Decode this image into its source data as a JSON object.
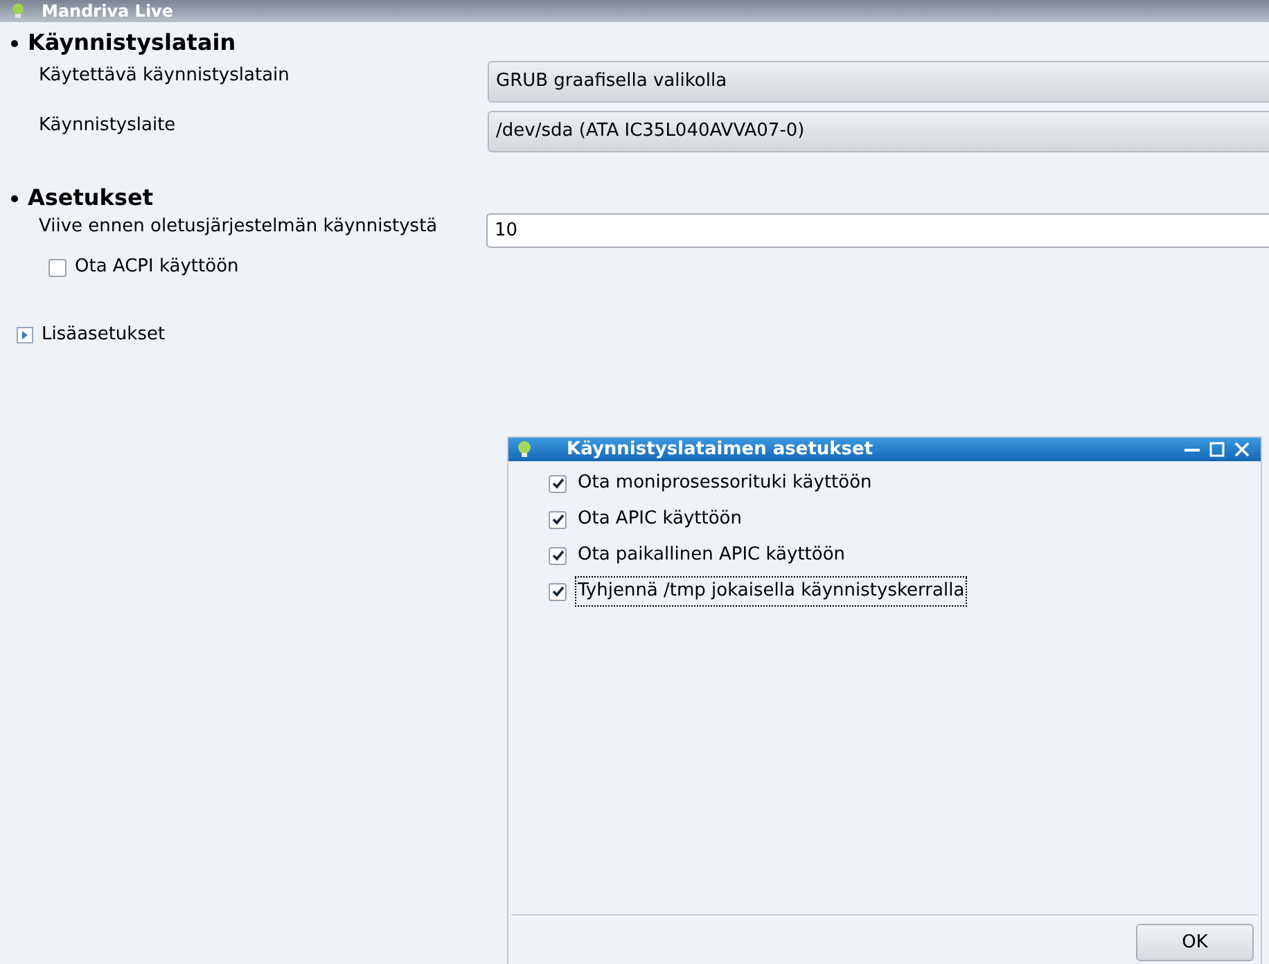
{
  "window": {
    "title": "Mandriva Live"
  },
  "sections": [
    {
      "title": "Käynnistyslatain",
      "rows": [
        {
          "kind": "combo",
          "label": "Käytettävä käynnistyslatain",
          "value": "GRUB graafisella valikolla"
        },
        {
          "kind": "combo",
          "label": "Käynnistyslaite",
          "value": "/dev/sda (ATA IC35L040AVVA07-0)"
        }
      ]
    },
    {
      "title": "Asetukset",
      "rows": [
        {
          "kind": "entry",
          "label": "Viive ennen oletusjärjestelmän käynnistystä",
          "value": "10"
        },
        {
          "kind": "checkbox",
          "label": "Ota ACPI käyttöön",
          "checked": false
        }
      ]
    }
  ],
  "expander": {
    "label": "Lisäasetukset",
    "expanded": false
  },
  "dialog": {
    "title": "Käynnistyslataimen asetukset",
    "options": [
      {
        "label": "Ota moniprosessorituki käyttöön",
        "checked": true,
        "focused": false
      },
      {
        "label": "Ota APIC käyttöön",
        "checked": true,
        "focused": false
      },
      {
        "label": "Ota paikallinen APIC käyttöön",
        "checked": true,
        "focused": false
      },
      {
        "label": "Tyhjennä /tmp jokaisella käynnistyskerralla",
        "checked": true,
        "focused": true
      }
    ],
    "buttons": [
      "OK"
    ]
  }
}
